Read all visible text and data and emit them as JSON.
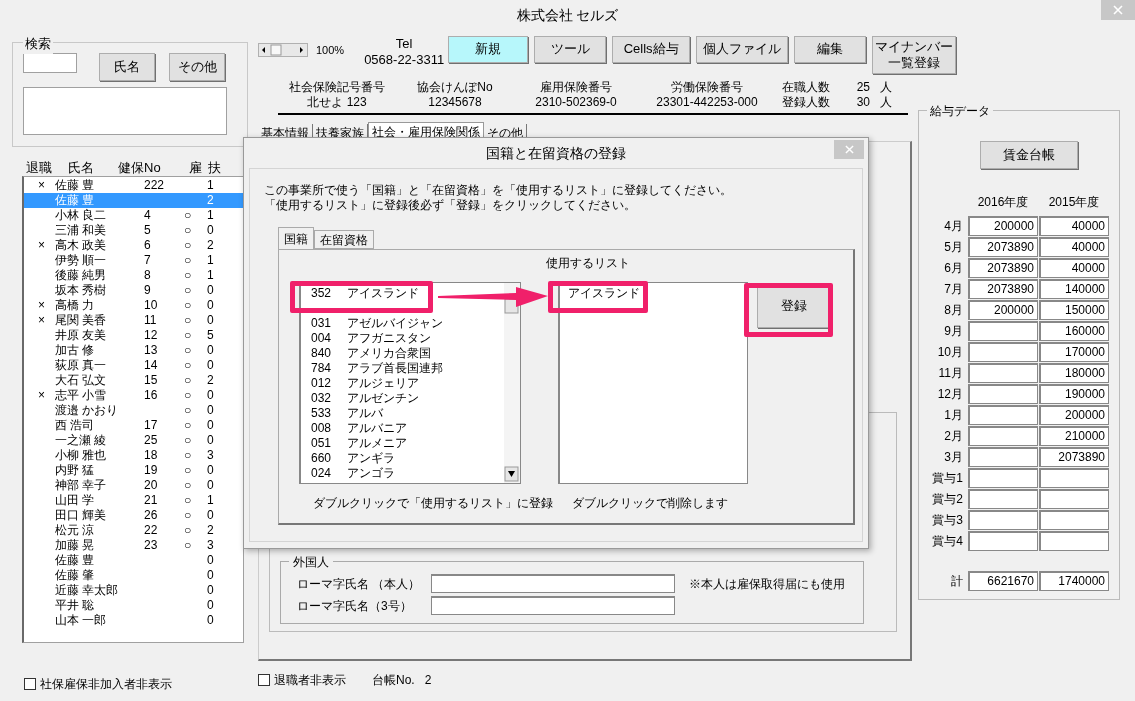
{
  "window": {
    "title": "株式会社 セルズ"
  },
  "search": {
    "title": "検索",
    "buttons": [
      "氏名",
      "その他"
    ]
  },
  "employees": {
    "columns": [
      "退職",
      "氏名",
      "健保No",
      "雇",
      "扶"
    ],
    "rows": [
      {
        "retired": "×",
        "name": "佐藤 豊",
        "no": "222",
        "dependents": "1",
        "selected": false
      },
      {
        "name": "佐藤 豊",
        "dependents": "2",
        "selected": true
      },
      {
        "name": "小林 良二",
        "no": "4",
        "employment": "○",
        "dependents": "1",
        "selected": false
      },
      {
        "name": "三浦 和美",
        "no": "5",
        "employment": "○",
        "dependents": "0",
        "selected": false
      },
      {
        "retired": "×",
        "name": "高木 政美",
        "no": "6",
        "employment": "○",
        "dependents": "2",
        "selected": false
      },
      {
        "name": "伊勢 順一",
        "no": "7",
        "employment": "○",
        "dependents": "1",
        "selected": false
      },
      {
        "name": "後藤 純男",
        "no": "8",
        "employment": "○",
        "dependents": "1",
        "selected": false
      },
      {
        "name": "坂本 秀樹",
        "no": "9",
        "employment": "○",
        "dependents": "0",
        "selected": false
      },
      {
        "retired": "×",
        "name": "高橋 力",
        "no": "10",
        "employment": "○",
        "dependents": "0",
        "selected": false
      },
      {
        "retired": "×",
        "name": "尾関 美香",
        "no": "11",
        "employment": "○",
        "dependents": "0",
        "selected": false
      },
      {
        "name": "井原 友美",
        "no": "12",
        "employment": "○",
        "dependents": "5",
        "selected": false
      },
      {
        "name": "加古 修",
        "no": "13",
        "employment": "○",
        "dependents": "0",
        "selected": false
      },
      {
        "name": "荻原 真一",
        "no": "14",
        "employment": "○",
        "dependents": "0",
        "selected": false
      },
      {
        "name": "大石 弘文",
        "no": "15",
        "employment": "○",
        "dependents": "2",
        "selected": false
      },
      {
        "retired": "×",
        "name": "志平 小雪",
        "no": "16",
        "employment": "○",
        "dependents": "0",
        "selected": false
      },
      {
        "name": "渡邉 かおり",
        "employment": "○",
        "dependents": "0",
        "selected": false
      },
      {
        "name": "西 浩司",
        "no": "17",
        "employment": "○",
        "dependents": "0",
        "selected": false
      },
      {
        "name": "一之瀬 綾",
        "no": "25",
        "employment": "○",
        "dependents": "0",
        "selected": false
      },
      {
        "name": "小柳 雅也",
        "no": "18",
        "employment": "○",
        "dependents": "3",
        "selected": false
      },
      {
        "name": "内野 猛",
        "no": "19",
        "employment": "○",
        "dependents": "0",
        "selected": false
      },
      {
        "name": "神部 幸子",
        "no": "20",
        "employment": "○",
        "dependents": "0",
        "selected": false
      },
      {
        "name": "山田 学",
        "no": "21",
        "employment": "○",
        "dependents": "1",
        "selected": false
      },
      {
        "name": "田口 輝美",
        "no": "26",
        "employment": "○",
        "dependents": "0",
        "selected": false
      },
      {
        "name": "松元 涼",
        "no": "22",
        "employment": "○",
        "dependents": "2",
        "selected": false
      },
      {
        "name": "加藤 晃",
        "no": "23",
        "employment": "○",
        "dependents": "3",
        "selected": false
      },
      {
        "name": "佐藤 豊",
        "dependents": "0",
        "selected": false
      },
      {
        "name": "佐藤 肇",
        "dependents": "0",
        "selected": false
      },
      {
        "name": "近藤 幸太郎",
        "dependents": "0",
        "selected": false
      },
      {
        "name": "平井 聡",
        "dependents": "0",
        "selected": false
      },
      {
        "name": "山本 一郎",
        "dependents": "0",
        "selected": false
      }
    ]
  },
  "hide_uninsured": {
    "label": "社保雇保非加入者非表示",
    "checked": false
  },
  "toolbar": {
    "zoom": "100%",
    "tel_label": "Tel",
    "tel": "0568-22-3311",
    "buttons": [
      {
        "label": "新規",
        "active": true
      },
      {
        "label": "ツール",
        "active": false
      },
      {
        "label": "Cells給与",
        "active": false
      },
      {
        "label": "個人ファイル",
        "active": false
      },
      {
        "label": "編集",
        "active": false
      },
      {
        "label": "マイナンバー一覧登録",
        "active": false
      }
    ]
  },
  "info": [
    {
      "label": "社会保険記号番号",
      "value": "北せよ 123"
    },
    {
      "label": "協会けんぽNo",
      "value": "12345678"
    },
    {
      "label": "雇用保険番号",
      "value": "2310-502369-0"
    },
    {
      "label": "労働保険番号",
      "value": "23301-442253-000"
    }
  ],
  "counts": [
    {
      "label": "在職人数",
      "value": "25",
      "unit": "人"
    },
    {
      "label": "登録人数",
      "value": "30",
      "unit": "人"
    }
  ],
  "tabs": [
    {
      "label": "基本情報",
      "selected": false
    },
    {
      "label": "扶養家族",
      "selected": false
    },
    {
      "label": "社会・雇用保険関係",
      "selected": true
    },
    {
      "label": "その他",
      "selected": false
    }
  ],
  "dialog": {
    "title": "国籍と在留資格の登録",
    "instructions": [
      "この事業所で使う「国籍」と「在留資格」を「使用するリスト」に登録してください。",
      "「使用するリスト」に登録後必ず「登録」をクリックしてください。"
    ],
    "tabs": [
      {
        "label": "国籍",
        "selected": true
      },
      {
        "label": "在留資格",
        "selected": false
      }
    ],
    "nationalities": [
      {
        "code": "352",
        "name": "アイスランド"
      },
      {
        "code": "031",
        "name": "アゼルバイジャン"
      },
      {
        "code": "004",
        "name": "アフガニスタン"
      },
      {
        "code": "840",
        "name": "アメリカ合衆国"
      },
      {
        "code": "784",
        "name": "アラブ首長国連邦"
      },
      {
        "code": "012",
        "name": "アルジェリア"
      },
      {
        "code": "032",
        "name": "アルゼンチン"
      },
      {
        "code": "533",
        "name": "アルバ"
      },
      {
        "code": "008",
        "name": "アルバニア"
      },
      {
        "code": "051",
        "name": "アルメニア"
      },
      {
        "code": "660",
        "name": "アンギラ"
      },
      {
        "code": "024",
        "name": "アンゴラ"
      }
    ],
    "used_list_label": "使用するリスト",
    "used_list": [
      "アイスランド"
    ],
    "register_button": "登録",
    "left_hint": "ダブルクリックで「使用するリスト」に登録",
    "right_hint": "ダブルクリックで削除します"
  },
  "foreigner": {
    "title": "外国人",
    "fields": [
      {
        "label": "ローマ字氏名 （本人）"
      },
      {
        "label": "ローマ字氏名（3号）"
      }
    ],
    "note": "※本人は雇保取得届にも使用"
  },
  "footer": {
    "hide_retired": {
      "label": "退職者非表示",
      "checked": false
    },
    "ledger_label": "台帳No.",
    "ledger_no": "2"
  },
  "payroll": {
    "title": "給与データ",
    "button": "賃金台帳",
    "columns": [
      "2016年度",
      "2015年度"
    ],
    "rows": [
      {
        "label": "4月",
        "fy2016": "200000",
        "fy2015": "40000"
      },
      {
        "label": "5月",
        "fy2016": "2073890",
        "fy2015": "40000"
      },
      {
        "label": "6月",
        "fy2016": "2073890",
        "fy2015": "40000"
      },
      {
        "label": "7月",
        "fy2016": "2073890",
        "fy2015": "140000"
      },
      {
        "label": "8月",
        "fy2016": "200000",
        "fy2015": "150000"
      },
      {
        "label": "9月",
        "fy2015": "160000"
      },
      {
        "label": "10月",
        "fy2015": "170000"
      },
      {
        "label": "11月",
        "fy2015": "180000"
      },
      {
        "label": "12月",
        "fy2015": "190000"
      },
      {
        "label": "1月",
        "fy2015": "200000"
      },
      {
        "label": "2月",
        "fy2015": "210000"
      },
      {
        "label": "3月",
        "fy2015": "2073890"
      },
      {
        "label": "賞与1"
      },
      {
        "label": "賞与2"
      },
      {
        "label": "賞与3"
      },
      {
        "label": "賞与4"
      }
    ],
    "total": {
      "label": "計",
      "fy2016": "6621670",
      "fy2015": "1740000"
    }
  }
}
